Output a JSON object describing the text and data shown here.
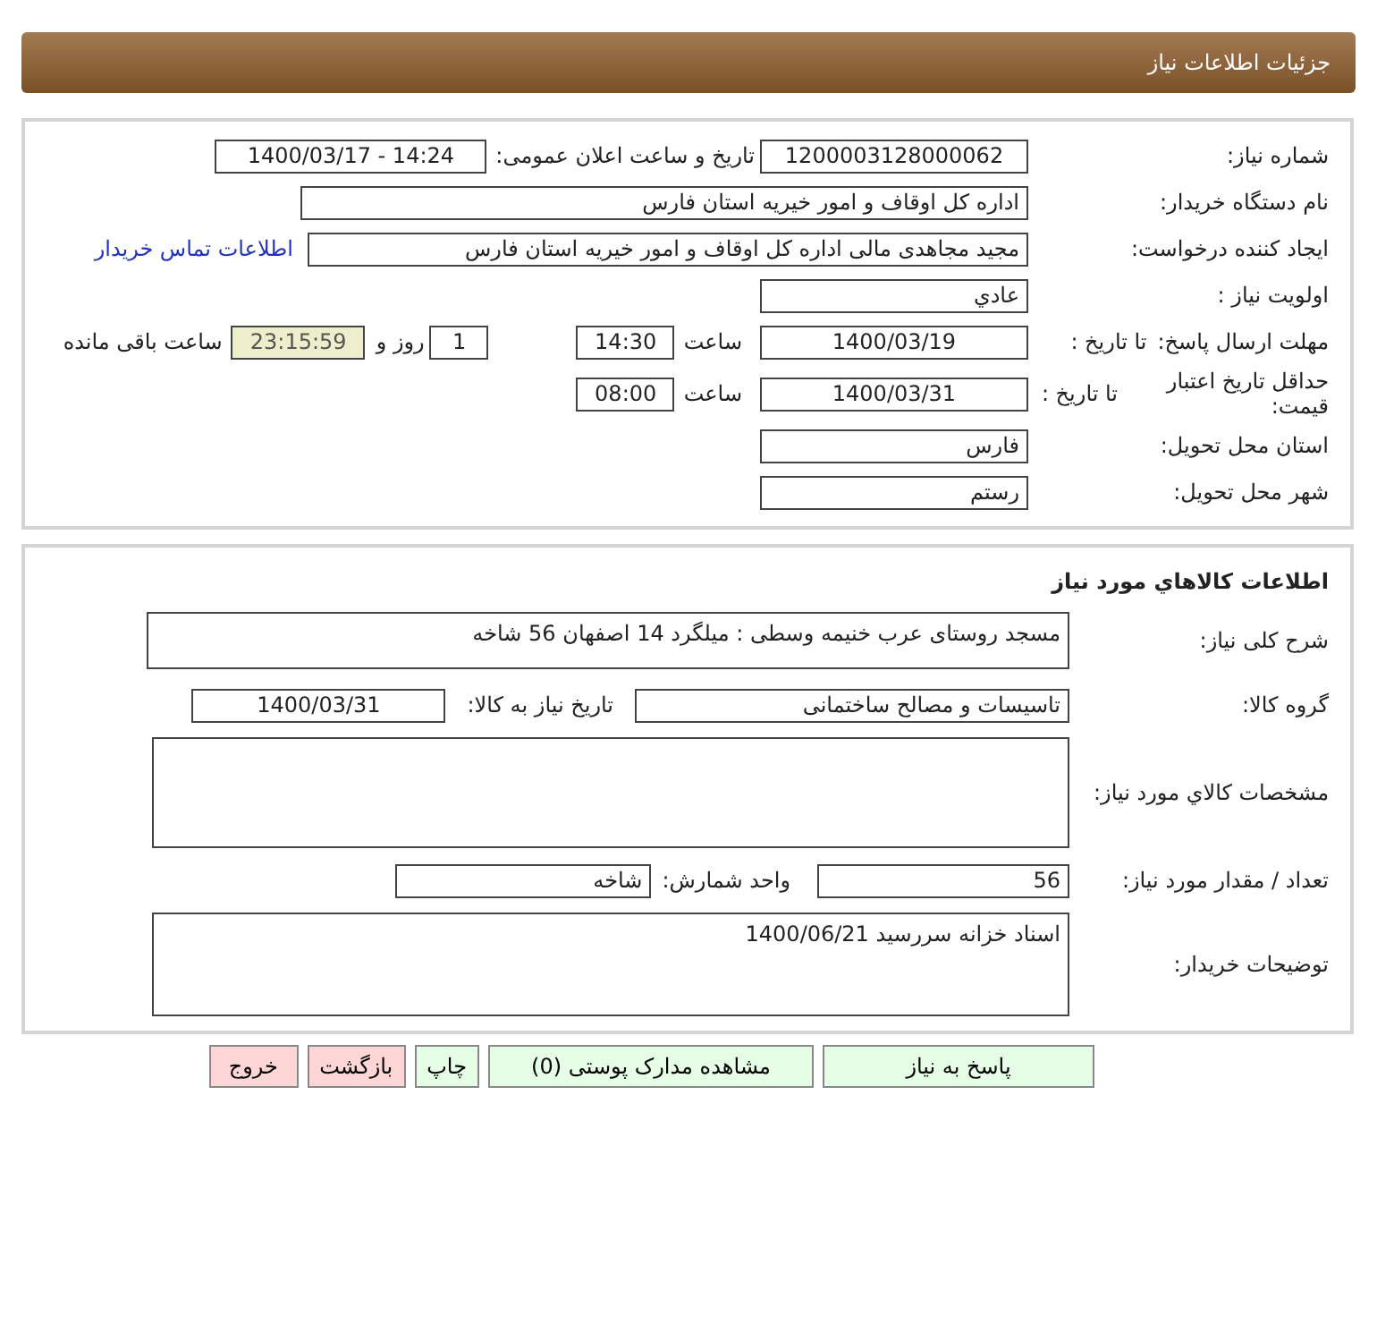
{
  "header": {
    "title": "جزئیات اطلاعات نیاز"
  },
  "need": {
    "need_number": {
      "label": "شماره نیاز:",
      "value": "1200003128000062"
    },
    "announce": {
      "label": "تاریخ و ساعت اعلان عمومی:",
      "value": "1400/03/17 - 14:24"
    },
    "buyer_org": {
      "label": "نام دستگاه خریدار:",
      "value": "اداره کل اوقاف و امور خیریه استان فارس"
    },
    "requester": {
      "label": "ایجاد کننده درخواست:",
      "value": "مجید مجاهدی مالی اداره کل اوقاف و امور خیریه استان فارس"
    },
    "contact_link": "اطلاعات تماس خریدار",
    "priority": {
      "label": "اولویت نیاز :",
      "value": "عادي"
    },
    "reply_deadline": {
      "label": "مهلت ارسال پاسخ:",
      "to_date_label": "تا تاریخ :",
      "date": "1400/03/19",
      "time_label": "ساعت",
      "time": "14:30",
      "days": "1",
      "days_label": "روز و",
      "remaining": "23:15:59",
      "remaining_label": "ساعت باقی مانده"
    },
    "price_validity": {
      "label": "حداقل تاریخ اعتبار قیمت:",
      "to_date_label": "تا تاریخ :",
      "date": "1400/03/31",
      "time_label": "ساعت",
      "time": "08:00"
    },
    "province": {
      "label": "استان محل تحویل:",
      "value": "فارس"
    },
    "city": {
      "label": "شهر محل تحویل:",
      "value": "رستم"
    }
  },
  "goods": {
    "title": "اطلاعات کالاهاي مورد نياز",
    "description": {
      "label": "شرح کلی نیاز:",
      "value": "مسجد روستای عرب خنیمه وسطی : میلگرد 14 اصفهان 56 شاخه"
    },
    "group": {
      "label": "گروه کالا:",
      "value": "تاسیسات و مصالح ساختمانی"
    },
    "need_date": {
      "label": "تاریخ نیاز به کالا:",
      "value": "1400/03/31"
    },
    "specs": {
      "label": "مشخصات کالاي مورد نياز:"
    },
    "quantity": {
      "label": "تعداد / مقدار مورد نیاز:",
      "value": "56"
    },
    "unit": {
      "label": "واحد شمارش:",
      "value": "شاخه"
    },
    "buyer_notes": {
      "label": "توضیحات خریدار:",
      "value": "اسناد خزانه سررسید 1400/06/21"
    }
  },
  "buttons": [
    {
      "label": "پاسخ به نیاز",
      "kind": "action"
    },
    {
      "label": "مشاهده مدارک پوستی (0)",
      "kind": "action"
    },
    {
      "label": "چاپ",
      "kind": "action"
    },
    {
      "label": "بازگشت",
      "kind": "exit"
    },
    {
      "label": "خروج",
      "kind": "exit"
    }
  ]
}
